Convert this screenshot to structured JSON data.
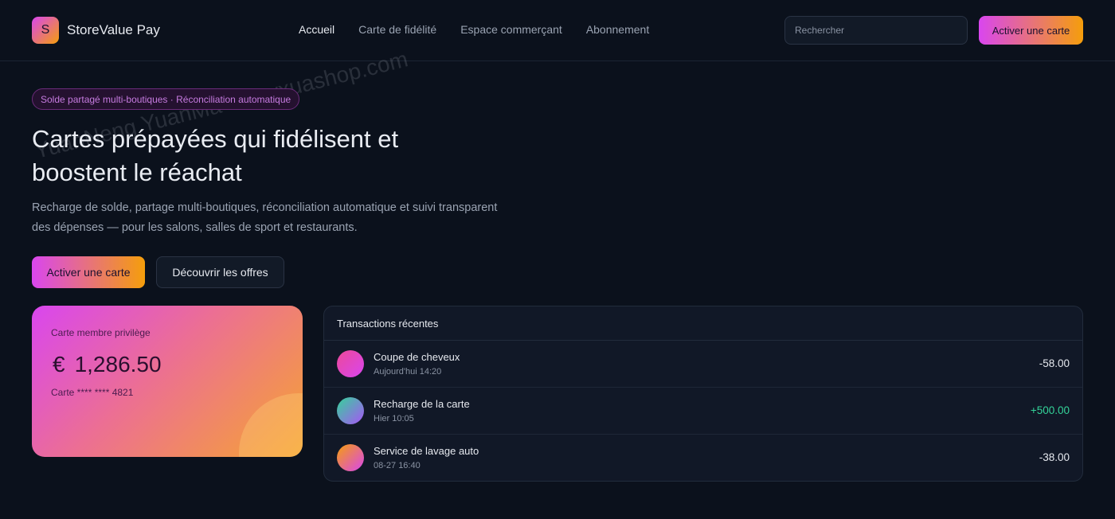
{
  "header": {
    "logo_letter": "S",
    "brand": "StoreValue Pay",
    "nav": [
      "Accueil",
      "Carte de fidélité",
      "Espace commerçant",
      "Abonnement"
    ],
    "search_placeholder": "Rechercher",
    "cta": "Activer une carte"
  },
  "hero": {
    "badge": "Solde partagé multi-boutiques · Réconciliation automatique",
    "title": "Cartes prépayées qui fidélisent et boostent le réachat",
    "subtitle": "Recharge de solde, partage multi-boutiques, réconciliation automatique et suivi transparent des dépenses — pour les salons, salles de sport et restaurants.",
    "primary_cta": "Activer une carte",
    "secondary_cta": "Découvrir les offres"
  },
  "card": {
    "label": "Carte membre privilège",
    "currency": "€",
    "balance": "1,286.50",
    "number": "Carte **** **** 4821"
  },
  "transactions": {
    "title": "Transactions récentes",
    "items": [
      {
        "title": "Coupe de cheveux",
        "time": "Aujourd'hui 14:20",
        "amount": "-58.00"
      },
      {
        "title": "Recharge de la carte",
        "time": "Hier 10:05",
        "amount": "+500.00"
      },
      {
        "title": "Service de lavage auto",
        "time": "08-27 16:40",
        "amount": "-38.00"
      }
    ]
  },
  "watermark": "YuanNeng YuanMa · inzyxuashop.com",
  "colors": {
    "accent_start": "#d946ef",
    "accent_end": "#f59e0b",
    "positive": "#34d399",
    "background": "#0b111c"
  }
}
